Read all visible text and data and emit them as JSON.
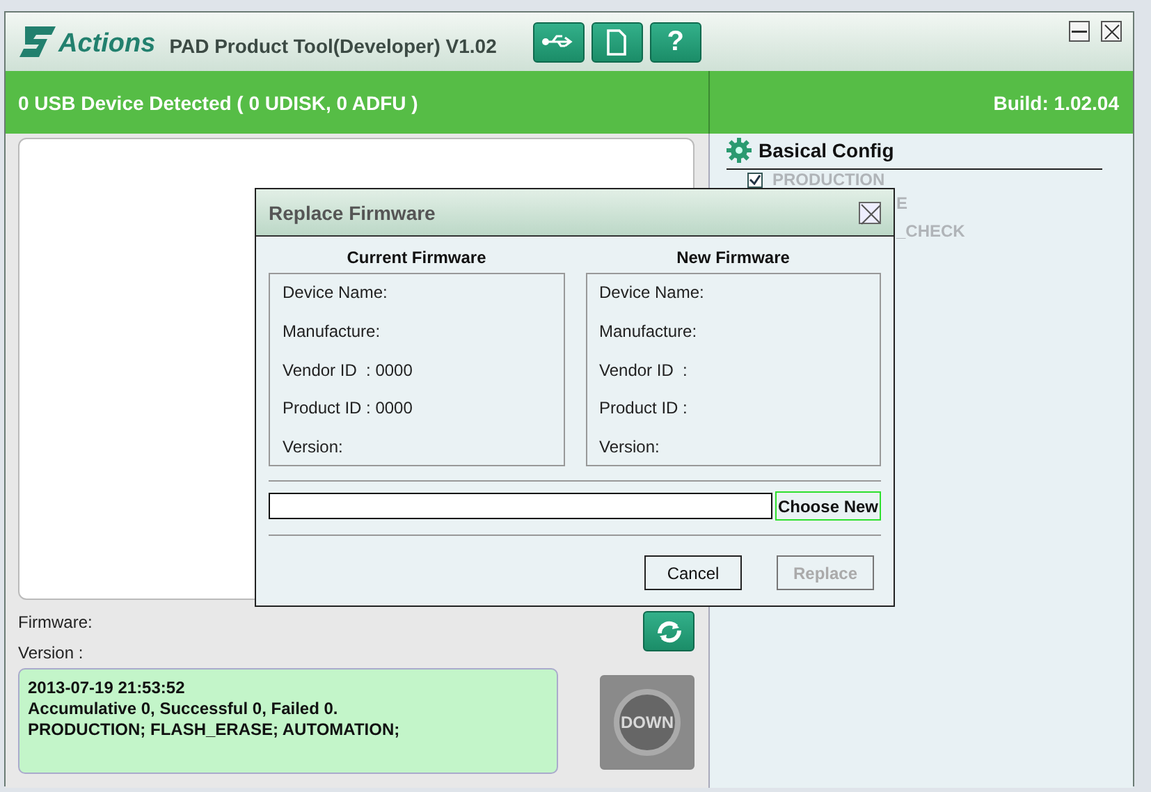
{
  "window": {
    "logo": "Actions",
    "title": "PAD Product Tool(Developer) V1.02",
    "toolbar": [
      {
        "kind": "usb"
      },
      {
        "kind": "document"
      },
      {
        "kind": "help",
        "label": "?"
      }
    ]
  },
  "status_bar": {
    "devices": "0 USB Device Detected ( 0 UDISK, 0 ADFU )",
    "build": "Build: 1.02.04"
  },
  "config": {
    "title": "Basical Config",
    "items": [
      {
        "label": "PRODUCTION",
        "checked": true,
        "disabled": true
      }
    ],
    "partial_items": [
      "E",
      "_CHECK"
    ]
  },
  "firmware_label": "Firmware:",
  "version_label": "Version :",
  "log": [
    "2013-07-19 21:53:52",
    "Accumulative 0, Successful 0, Failed 0.",
    "PRODUCTION; FLASH_ERASE; AUTOMATION;"
  ],
  "download_button": {
    "label": "DOWN",
    "disabled": true
  },
  "dialog": {
    "title": "Replace Firmware",
    "columns": [
      {
        "heading": "Current Firmware",
        "fields": [
          "Device Name:",
          "Manufacture:",
          "Vendor ID  : 0000",
          "Product ID : 0000",
          "Version:"
        ]
      },
      {
        "heading": "New Firmware",
        "fields": [
          "Device Name:",
          "Manufacture:",
          "Vendor ID  :",
          "Product ID :",
          "Version:"
        ]
      }
    ],
    "choose_button": {
      "label": "Choose New",
      "focused": true
    },
    "buttons": [
      {
        "label": "Cancel",
        "disabled": false
      },
      {
        "label": "Replace",
        "disabled": true
      }
    ]
  }
}
